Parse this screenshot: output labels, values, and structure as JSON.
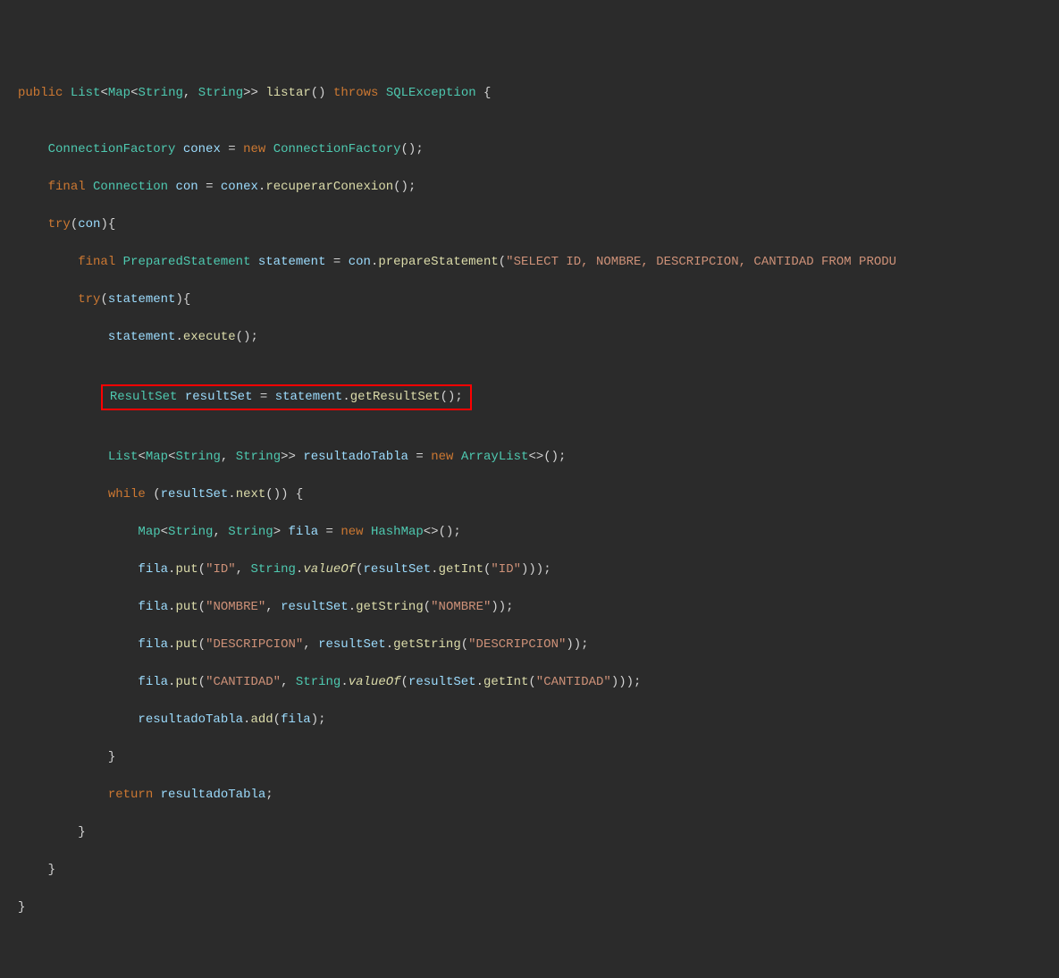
{
  "code": {
    "kw_public": "public",
    "type_list": "List",
    "type_map": "Map",
    "type_string": "String",
    "method_listar": "listar",
    "kw_throws": "throws",
    "type_sqlexception": "SQLException",
    "type_connectionfactory": "ConnectionFactory",
    "var_conex": "conex",
    "kw_new": "new",
    "kw_final": "final",
    "type_connection": "Connection",
    "var_con": "con",
    "method_recuperarconexion": "recuperarConexion",
    "kw_try": "try",
    "type_preparedstatement": "PreparedStatement",
    "var_statement": "statement",
    "method_preparestatement": "prepareStatement",
    "string_select": "\"SELECT ID, NOMBRE, DESCRIPCION, CANTIDAD FROM PRODU",
    "method_execute": "execute",
    "type_resultset": "ResultSet",
    "var_resultset": "resultSet",
    "method_getresultset": "getResultSet",
    "var_resultadotabla": "resultadoTabla",
    "type_arraylist": "ArrayList",
    "kw_while": "while",
    "method_next": "next",
    "var_fila": "fila",
    "type_hashmap": "HashMap",
    "method_put": "put",
    "string_id": "\"ID\"",
    "method_valueof": "valueOf",
    "method_getint": "getInt",
    "string_nombre": "\"NOMBRE\"",
    "method_getstring": "getString",
    "string_descripcion": "\"DESCRIPCION\"",
    "string_cantidad": "\"CANTIDAD\"",
    "method_add": "add",
    "kw_return": "return"
  }
}
